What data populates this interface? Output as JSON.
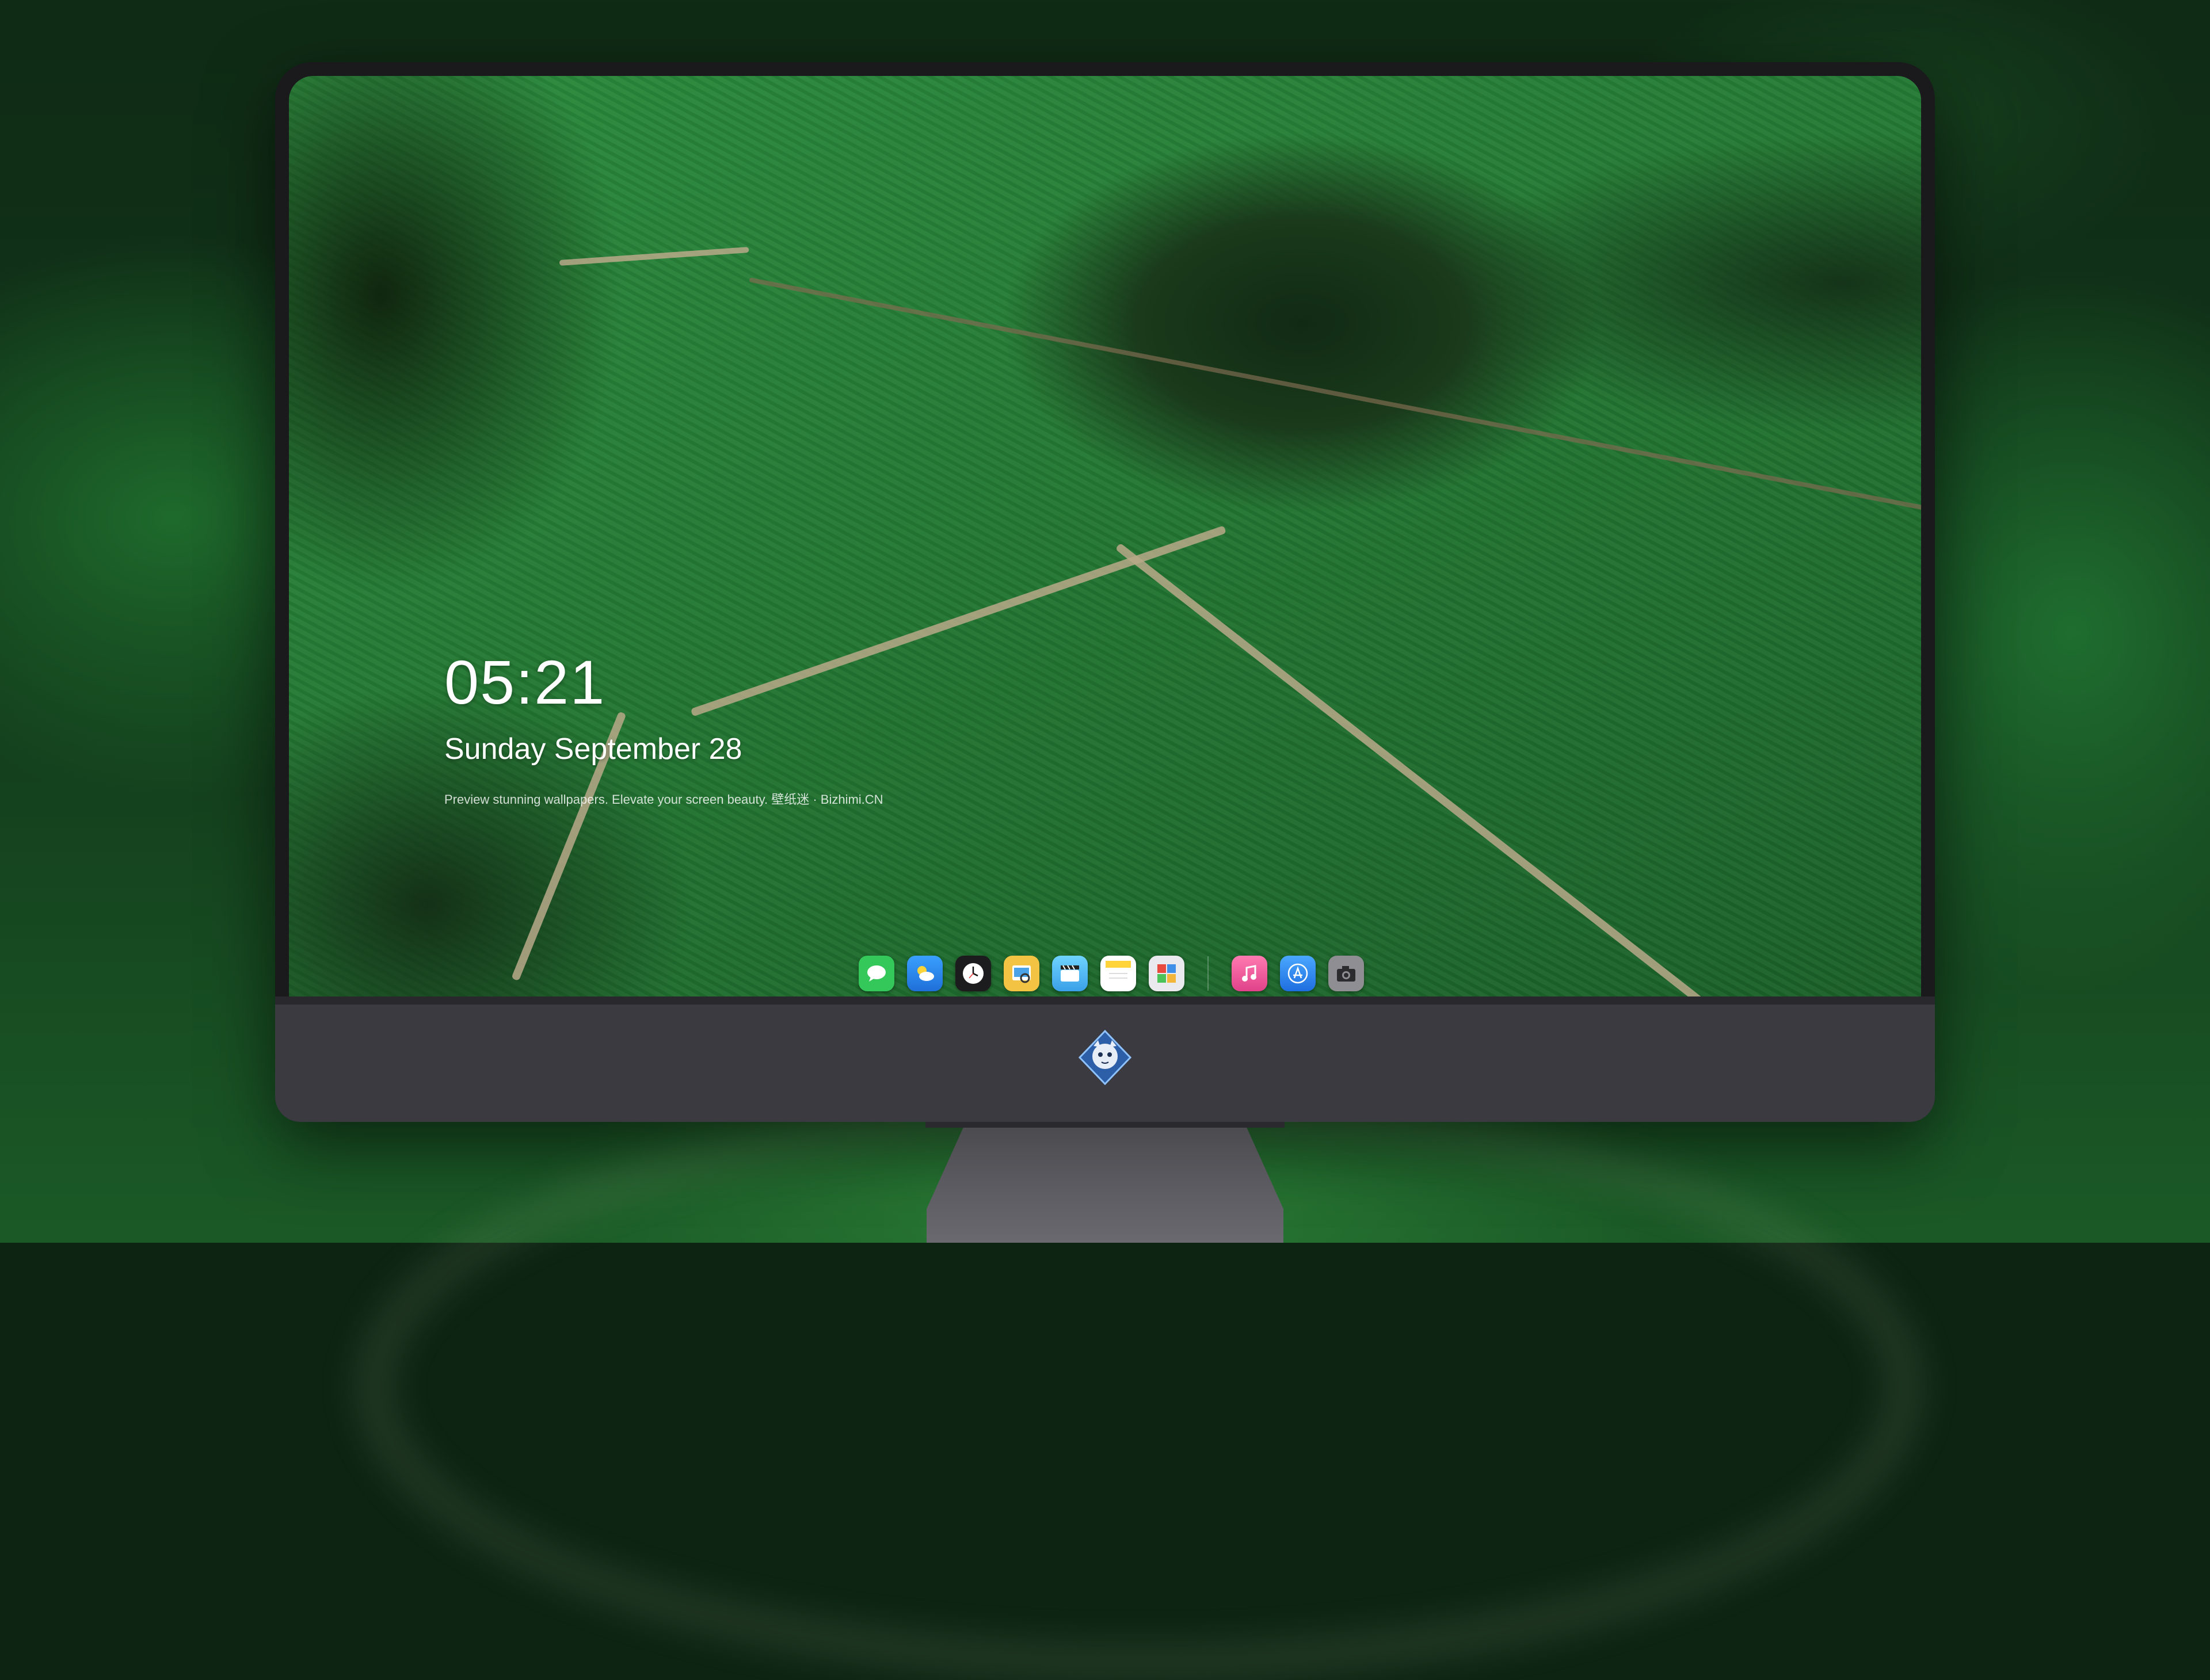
{
  "lockscreen": {
    "time": "05:21",
    "date": "Sunday September  28",
    "caption": "Preview stunning wallpapers. Elevate your screen beauty. 壁纸迷 · Bizhimi.CN"
  },
  "dock": {
    "apps": [
      {
        "name": "Messages",
        "icon": "messages-icon",
        "color": "#34c759"
      },
      {
        "name": "Weather",
        "icon": "weather-icon",
        "color": "#2f8cf0"
      },
      {
        "name": "Clock",
        "icon": "clock-icon",
        "color": "#1c1c1e"
      },
      {
        "name": "Preview",
        "icon": "preview-icon",
        "color": "#f3c443"
      },
      {
        "name": "Clips",
        "icon": "clips-icon",
        "color": "#5ac8fa"
      },
      {
        "name": "Notes",
        "icon": "notes-icon",
        "color": "#ffd43b"
      },
      {
        "name": "Photo Booth",
        "icon": "photo-booth-icon",
        "color": "#d6453d"
      },
      {
        "name": "Music",
        "icon": "music-icon",
        "color": "#f25a9a"
      },
      {
        "name": "App Store",
        "icon": "app-store-icon",
        "color": "#2f7cf6"
      },
      {
        "name": "Camera",
        "icon": "camera-icon",
        "color": "#8e8e93"
      }
    ]
  },
  "monitor": {
    "logo": "mascot-logo-icon"
  }
}
